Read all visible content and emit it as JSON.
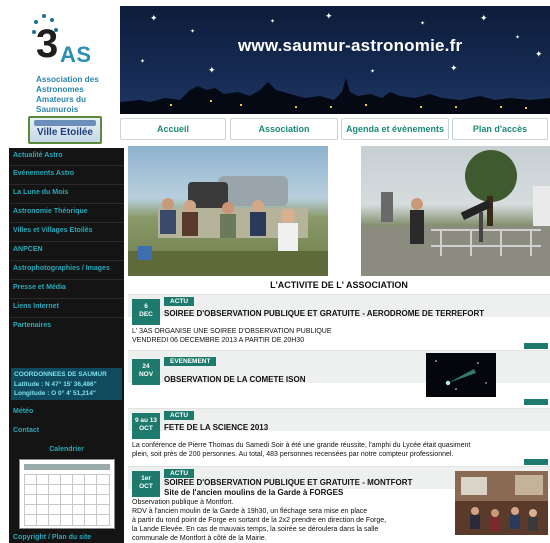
{
  "logo": {
    "text_3": "3",
    "text_as": "AS",
    "caption": "Association des Astronomes Amateurs du Saumurois",
    "badge": "Ville Etoilée"
  },
  "banner": {
    "title": "www.saumur-astronomie.fr"
  },
  "nav": {
    "items": [
      {
        "label": "Accueil"
      },
      {
        "label": "Association"
      },
      {
        "label": "Agenda et évènements"
      },
      {
        "label": "Plan d'accès"
      }
    ]
  },
  "sidebar": {
    "items": [
      {
        "label": "Actualité Astro"
      },
      {
        "label": "Evénements Astro"
      },
      {
        "label": "La Lune du Mois"
      },
      {
        "label": "Astronomie Théorique"
      },
      {
        "label": "Villes et Villages Etoilés"
      },
      {
        "label": "ANPCEN"
      },
      {
        "label": "Astrophotographies / Images"
      },
      {
        "label": "Presse et Média"
      },
      {
        "label": "Liens Internet"
      },
      {
        "label": "Partenaires"
      }
    ],
    "coords_title": "COORDONNEES DE SAUMUR",
    "latitude": "Latitude : N 47° 15' 36,486\"",
    "longitude": "Longitude : O 0° 4' 51,214\"",
    "meteo": "Météo",
    "contact": "Contact",
    "calendar_title": "Calendrier",
    "bottom_link": "Copyright / Plan du site"
  },
  "main": {
    "section_title": "L'ACTIVITE DE L' ASSOCIATION",
    "articles": [
      {
        "date_day": "6",
        "date_month": "DEC",
        "tag": "ACTU",
        "title": "SOIREE D'OBSERVATION PUBLIQUE ET GRATUITE - AERODROME DE TERREFORT",
        "body_1": "L' 3AS ORGANISE UNE SOIREE D'OBSERVATION PUBLIQUE",
        "body_2": "VENDREDI 06 DECEMBRE 2013 A PARTIR DE 20H30"
      },
      {
        "date_day": "24",
        "date_month": "NOV",
        "tag": "EVENEMENT",
        "title": "OBSERVATION DE LA COMETE ISON"
      },
      {
        "date_day": "9 au 13",
        "date_month": "OCT",
        "tag": "ACTU",
        "title": "FETE DE LA SCIENCE 2013",
        "body_1": "La conférence de Pierre Thomas du Samedi Soir à été une grande réussite, l'amphi du Lycée était quasiment",
        "body_2": "plein, soit près de 200 personnes. Au total, 483 personnes recensées par notre compteur professionnel."
      },
      {
        "date_day": "1er",
        "date_month": "OCT",
        "tag": "ACTU",
        "title": "SOIREE D'OBSERVATION PUBLIQUE ET GRATUITE - MONTFORT",
        "subtitle": "Site de l'ancien moulins de la Garde à FORGES",
        "body_1": "Observation publique à Montfort.",
        "body_2": "RDV à l'ancien moulin de la Garde à 19h30, un fléchage sera mise en place",
        "body_3": "à partir du rond point de Forge en sortant de la 2x2  prendre en direction de Forge,",
        "body_4": "la Lande Elevée. En cas de mauvais temps, la soirée se déroulera dans la salle",
        "body_5": "communale de Montfort à côté de la Mairie."
      }
    ]
  }
}
